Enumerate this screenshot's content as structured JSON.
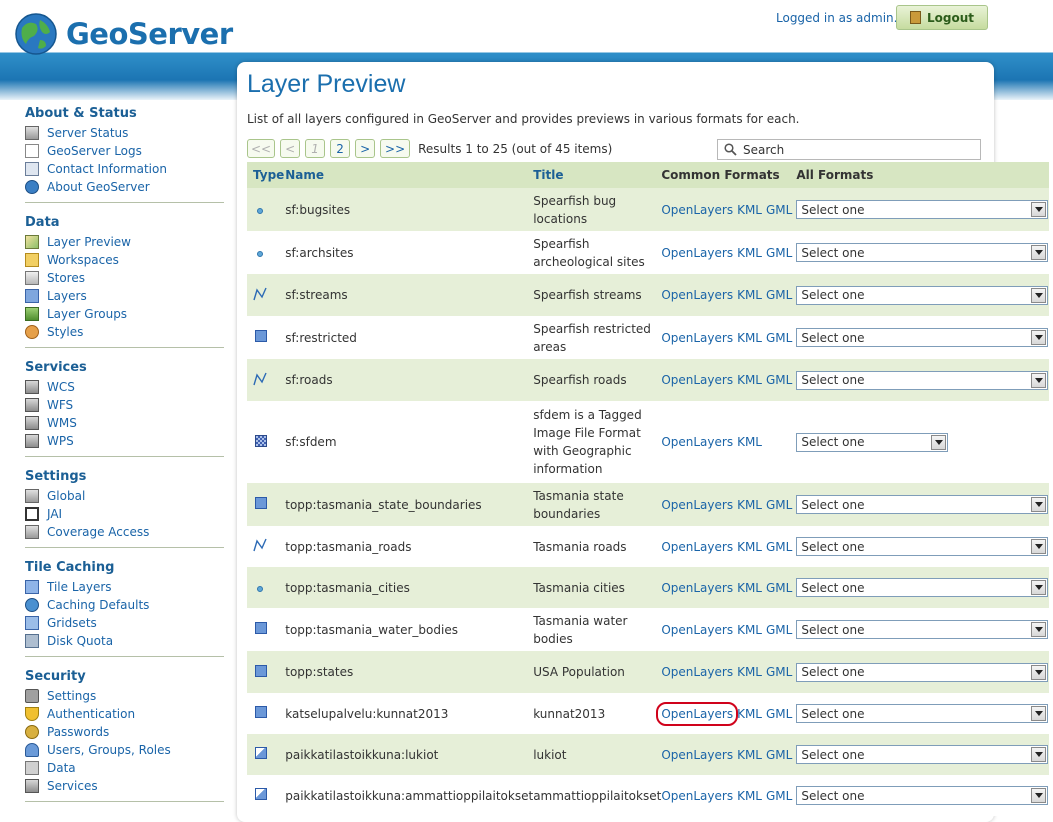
{
  "header": {
    "brand": "GeoServer",
    "logged_in": "Logged in as admin.",
    "logout_label": "Logout"
  },
  "sidebar": {
    "sections": [
      {
        "title": "About & Status",
        "items": [
          {
            "label": "Server Status",
            "icon": "server-icon"
          },
          {
            "label": "GeoServer Logs",
            "icon": "document-icon"
          },
          {
            "label": "Contact Information",
            "icon": "contact-icon"
          },
          {
            "label": "About GeoServer",
            "icon": "info-icon"
          }
        ]
      },
      {
        "title": "Data",
        "items": [
          {
            "label": "Layer Preview",
            "icon": "map-icon"
          },
          {
            "label": "Workspaces",
            "icon": "folder-icon"
          },
          {
            "label": "Stores",
            "icon": "store-icon"
          },
          {
            "label": "Layers",
            "icon": "layers-icon"
          },
          {
            "label": "Layer Groups",
            "icon": "layer-groups-icon"
          },
          {
            "label": "Styles",
            "icon": "palette-icon"
          }
        ]
      },
      {
        "title": "Services",
        "items": [
          {
            "label": "WCS",
            "icon": "service-icon"
          },
          {
            "label": "WFS",
            "icon": "service-icon"
          },
          {
            "label": "WMS",
            "icon": "service-icon"
          },
          {
            "label": "WPS",
            "icon": "service-icon"
          }
        ]
      },
      {
        "title": "Settings",
        "items": [
          {
            "label": "Global",
            "icon": "server-icon"
          },
          {
            "label": "JAI",
            "icon": "jai-icon"
          },
          {
            "label": "Coverage Access",
            "icon": "server-icon"
          }
        ]
      },
      {
        "title": "Tile Caching",
        "items": [
          {
            "label": "Tile Layers",
            "icon": "tile-icon"
          },
          {
            "label": "Caching Defaults",
            "icon": "globe-icon"
          },
          {
            "label": "Gridsets",
            "icon": "grid-icon"
          },
          {
            "label": "Disk Quota",
            "icon": "disk-icon"
          }
        ]
      },
      {
        "title": "Security",
        "items": [
          {
            "label": "Settings",
            "icon": "wrench-icon"
          },
          {
            "label": "Authentication",
            "icon": "shield-icon"
          },
          {
            "label": "Passwords",
            "icon": "key-icon"
          },
          {
            "label": "Users, Groups, Roles",
            "icon": "users-icon"
          },
          {
            "label": "Data",
            "icon": "data-icon"
          },
          {
            "label": "Services",
            "icon": "services-icon"
          }
        ]
      }
    ]
  },
  "main": {
    "title": "Layer Preview",
    "description": "List of all layers configured in GeoServer and provides previews in various formats for each.",
    "pager": {
      "first": "<<",
      "prev": "<",
      "page1": "1",
      "page2": "2",
      "next": ">",
      "last": ">>",
      "results": "Results 1 to 25 (out of 45 items)"
    },
    "search_placeholder": "Search",
    "columns": [
      "Type",
      "Name",
      "Title",
      "Common Formats",
      "All Formats"
    ],
    "select_default": "Select one",
    "rows": [
      {
        "type": "point",
        "name": "sf:bugsites",
        "title": "Spearfish bug locations",
        "formats": [
          "OpenLayers",
          "KML",
          "GML"
        ]
      },
      {
        "type": "point",
        "name": "sf:archsites",
        "title": "Spearfish archeological sites",
        "formats": [
          "OpenLayers",
          "KML",
          "GML"
        ]
      },
      {
        "type": "line",
        "name": "sf:streams",
        "title": "Spearfish streams",
        "formats": [
          "OpenLayers",
          "KML",
          "GML"
        ]
      },
      {
        "type": "polygon",
        "name": "sf:restricted",
        "title": "Spearfish restricted areas",
        "formats": [
          "OpenLayers",
          "KML",
          "GML"
        ]
      },
      {
        "type": "line",
        "name": "sf:roads",
        "title": "Spearfish roads",
        "formats": [
          "OpenLayers",
          "KML",
          "GML"
        ]
      },
      {
        "type": "raster",
        "name": "sf:sfdem",
        "title": "sfdem is a Tagged Image File Format with Geographic information",
        "formats": [
          "OpenLayers",
          "KML"
        ]
      },
      {
        "type": "polygon",
        "name": "topp:tasmania_state_boundaries",
        "title": "Tasmania state boundaries",
        "formats": [
          "OpenLayers",
          "KML",
          "GML"
        ]
      },
      {
        "type": "line",
        "name": "topp:tasmania_roads",
        "title": "Tasmania roads",
        "formats": [
          "OpenLayers",
          "KML",
          "GML"
        ]
      },
      {
        "type": "point",
        "name": "topp:tasmania_cities",
        "title": "Tasmania cities",
        "formats": [
          "OpenLayers",
          "KML",
          "GML"
        ]
      },
      {
        "type": "polygon",
        "name": "topp:tasmania_water_bodies",
        "title": "Tasmania water bodies",
        "formats": [
          "OpenLayers",
          "KML",
          "GML"
        ]
      },
      {
        "type": "polygon",
        "name": "topp:states",
        "title": "USA Population",
        "formats": [
          "OpenLayers",
          "KML",
          "GML"
        ]
      },
      {
        "type": "polygon",
        "name": "katselupalvelu:kunnat2013",
        "title": "kunnat2013",
        "formats": [
          "OpenLayers",
          "KML",
          "GML"
        ],
        "highlight": "OpenLayers"
      },
      {
        "type": "group",
        "name": "paikkatilastoikkuna:lukiot",
        "title": "lukiot",
        "formats": [
          "OpenLayers",
          "KML",
          "GML"
        ]
      },
      {
        "type": "group",
        "name": "paikkatilastoikkuna:ammattioppilaitokset",
        "title": "ammattioppilaitokset",
        "formats": [
          "OpenLayers",
          "KML",
          "GML"
        ]
      }
    ]
  },
  "colors": {
    "accent": "#1b6fae",
    "row_alt": "#e6efd8",
    "header_bg": "#d7e6c2",
    "highlight": "#d0021b"
  }
}
